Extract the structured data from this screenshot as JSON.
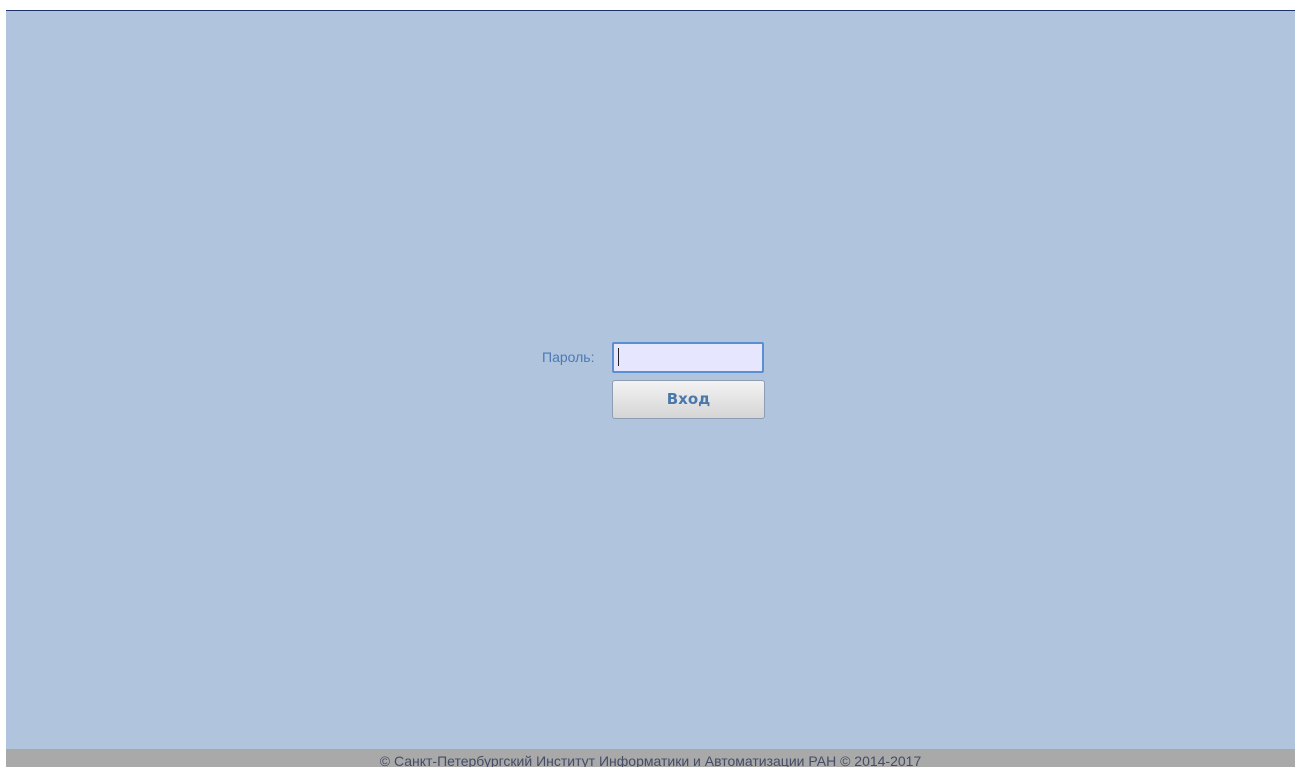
{
  "login": {
    "password_label": "Пароль:",
    "password_value": "",
    "password_placeholder": "",
    "submit_label": "Вход"
  },
  "footer": {
    "copyright": "© Санкт-Петербургский Институт Информатики и Автоматизации РАН © 2014-2017"
  },
  "colors": {
    "background": "#b0c4de",
    "label": "#4a7ab5",
    "input_background": "#e6e6ff",
    "input_border": "#5b8fd0",
    "button_text": "#4b78aa",
    "footer_background": "#a9a9a9",
    "top_line": "#1c2f6b"
  }
}
